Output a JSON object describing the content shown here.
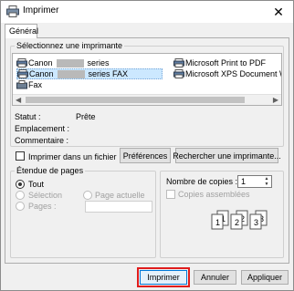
{
  "window": {
    "title": "Imprimer",
    "close_glyph": "✕"
  },
  "tabs": [
    {
      "label": "Général"
    }
  ],
  "printer_group": {
    "label": "Sélectionnez une imprimante",
    "printers": [
      {
        "name_prefix": "Canon",
        "name_suffix": "series",
        "icon": "printer-icon"
      },
      {
        "name_prefix": "Canon",
        "name_suffix": "series FAX",
        "icon": "printer-icon"
      },
      {
        "name": "Fax",
        "icon": "fax-icon"
      },
      {
        "name": "Microsoft Print to PDF",
        "icon": "printer-icon"
      },
      {
        "name": "Microsoft XPS Document W",
        "icon": "printer-icon"
      }
    ],
    "selected_index": 1
  },
  "status": {
    "statut_label": "Statut :",
    "statut_value": "Prête",
    "emplacement_label": "Emplacement :",
    "commentaire_label": "Commentaire :"
  },
  "actions": {
    "print_to_file": "Imprimer dans un fichier",
    "preferences": "Préférences",
    "find_printer": "Rechercher une imprimante..."
  },
  "page_range": {
    "label": "Étendue de pages",
    "all": "Tout",
    "selection": "Sélection",
    "current_page": "Page actuelle",
    "pages": "Pages :",
    "selected": "Tout"
  },
  "copies": {
    "label": "Nombre de copies :",
    "value": "1",
    "collate": "Copies assemblées",
    "collate_checked": false
  },
  "footer": {
    "print": "Imprimer",
    "cancel": "Annuler",
    "apply": "Appliquer"
  }
}
